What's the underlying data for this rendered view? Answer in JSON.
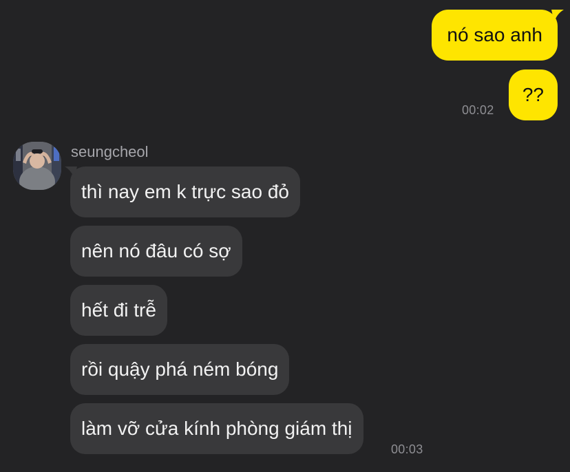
{
  "outgoing": {
    "messages": [
      "nó sao anh",
      "??"
    ],
    "time": "00:02"
  },
  "incoming": {
    "sender": "seungcheol",
    "avatar": "profile-photo",
    "messages": [
      "thì nay em k trực sao đỏ",
      "nên nó đâu có sợ",
      "hết đi trễ",
      "rồi quậy phá ném bóng",
      "làm vỡ cửa kính phòng giám thị"
    ],
    "time": "00:03"
  },
  "colors": {
    "background": "#232325",
    "outgoing_bubble": "#fee500",
    "incoming_bubble": "#39393b"
  }
}
